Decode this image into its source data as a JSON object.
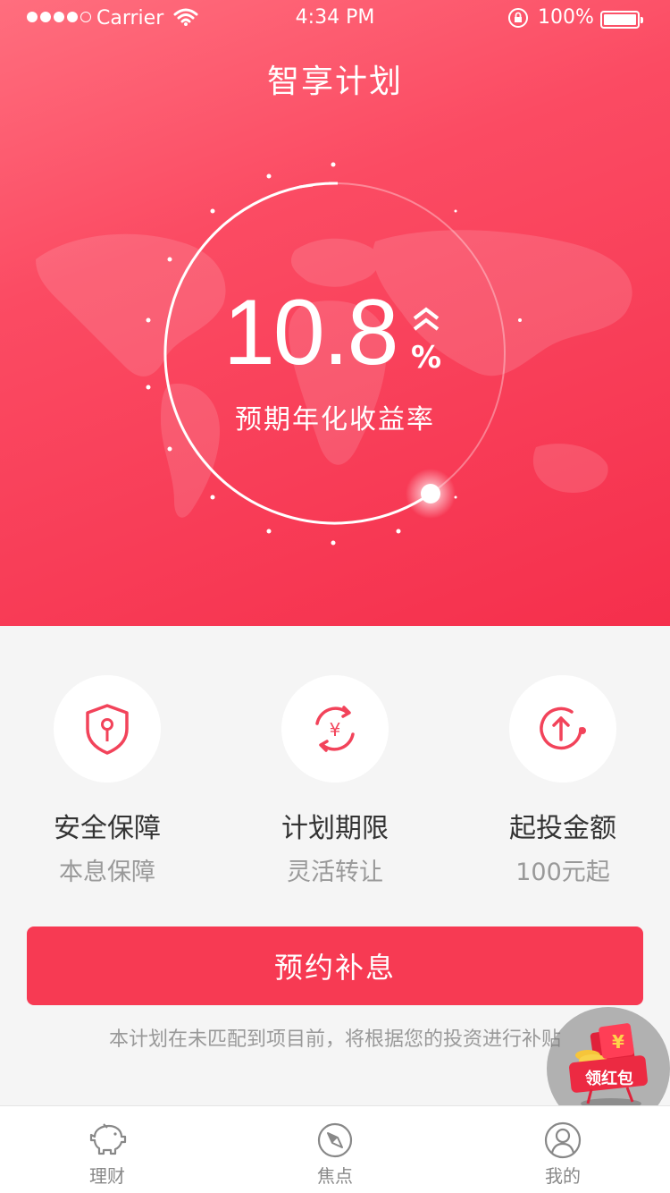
{
  "status_bar": {
    "carrier": "Carrier",
    "time": "4:34 PM",
    "battery": "100%"
  },
  "header": {
    "title": "智享计划"
  },
  "rate": {
    "value": "10.8",
    "unit": "%",
    "label": "预期年化收益率"
  },
  "features": [
    {
      "icon": "shield-icon",
      "title": "安全保障",
      "subtitle": "本息保障"
    },
    {
      "icon": "yuan-cycle-icon",
      "title": "计划期限",
      "subtitle": "灵活转让"
    },
    {
      "icon": "arrow-up-circle-icon",
      "title": "起投金额",
      "subtitle": "100元起"
    }
  ],
  "cta": {
    "label": "预约补息"
  },
  "note": "本计划在未匹配到项目前，将根据您的投资进行补贴",
  "redpack": {
    "label": "领红包",
    "symbol": "¥"
  },
  "tabs": [
    {
      "label": "理财",
      "icon": "piggy-bank-icon"
    },
    {
      "label": "焦点",
      "icon": "compass-icon"
    },
    {
      "label": "我的",
      "icon": "user-icon"
    }
  ],
  "colors": {
    "primary": "#f73a53",
    "hero_light": "#ff6e7e",
    "hero_dark": "#f52f4c"
  }
}
